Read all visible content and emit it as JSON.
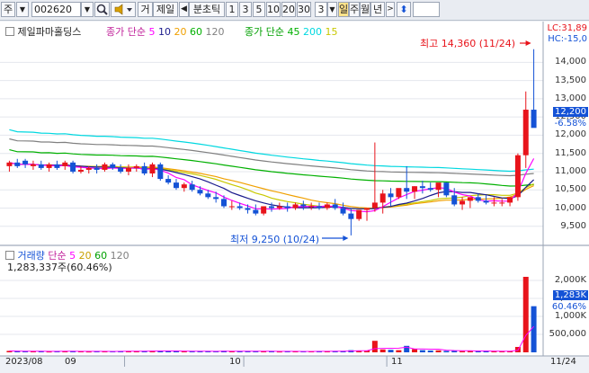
{
  "toolbar": {
    "market_label": "주",
    "code_value": "002620",
    "search_icon": "search-icon",
    "speaker_icon": "speaker-icon",
    "mode_label": "거",
    "name_label": "제일",
    "prev_icon": "arrow-left-icon",
    "period_label": "분초틱",
    "intervals": [
      "1",
      "3",
      "5",
      "10",
      "20",
      "30"
    ],
    "count_value": "3",
    "period_day": "일",
    "period_week": "주",
    "period_month": "월",
    "period_year": "년",
    "next_icon": "arrow-right-icon",
    "updown_icon": "arrows-updown-icon"
  },
  "price_panel": {
    "stock_name": "제일파마홀딩스",
    "ma_title": "종가 단순",
    "ma_periods": [
      "5",
      "10",
      "20",
      "60",
      "120"
    ],
    "ma_long_title": "종가 단순",
    "ma_long_periods": [
      "45",
      "200",
      "15"
    ],
    "lc_label": "LC:31,89",
    "hc_label": "HC:-15,0",
    "high_label": "최고 14,360 (11/24)",
    "low_label": "최저 9,250 (10/24)",
    "current_price": "12,200",
    "change_pct": "-6.58%",
    "y_ticks": [
      "14,000",
      "13,500",
      "13,000",
      "12,500",
      "12,000",
      "11,500",
      "11,000",
      "10,500",
      "10,000",
      "9,500"
    ]
  },
  "volume_panel": {
    "title": "거래량",
    "ma_title": "단순",
    "ma_periods": [
      "5",
      "20",
      "60",
      "120"
    ],
    "volume_value": "1,283,337주(60.46%)",
    "current_volume": "1,283K",
    "current_pct": "60.46%",
    "y_ticks": [
      "2,000K",
      "1,500K",
      "1,000K",
      "500,000"
    ]
  },
  "x_axis": {
    "labels": [
      "2023/08",
      "09",
      "10",
      "11",
      "11/24"
    ]
  },
  "colors": {
    "up": "#e8141b",
    "down": "#1452d6",
    "ma5": "#ff00ff",
    "ma10": "#1a1a8c",
    "ma20": "#f0a000",
    "ma60": "#00b000",
    "ma120": "#808080",
    "ma200": "#00d8e0",
    "ma15": "#c8c800"
  },
  "chart_data": {
    "type": "candlestick",
    "dates": [
      "08/17",
      "08/18",
      "08/21",
      "08/22",
      "08/23",
      "08/24",
      "08/25",
      "08/28",
      "08/29",
      "08/30",
      "08/31",
      "09/01",
      "09/04",
      "09/05",
      "09/06",
      "09/07",
      "09/08",
      "09/11",
      "09/12",
      "09/13",
      "09/14",
      "09/15",
      "09/18",
      "09/19",
      "09/20",
      "09/21",
      "09/22",
      "09/25",
      "09/26",
      "09/27",
      "10/04",
      "10/05",
      "10/06",
      "10/10",
      "10/11",
      "10/12",
      "10/13",
      "10/16",
      "10/17",
      "10/18",
      "10/19",
      "10/20",
      "10/23",
      "10/24",
      "10/25",
      "10/26",
      "10/27",
      "10/30",
      "10/31",
      "11/01",
      "11/02",
      "11/03",
      "11/06",
      "11/07",
      "11/08",
      "11/09",
      "11/10",
      "11/13",
      "11/14",
      "11/15",
      "11/16",
      "11/17",
      "11/20",
      "11/21",
      "11/22",
      "11/23",
      "11/24"
    ],
    "open": [
      11150,
      11250,
      11300,
      11150,
      11200,
      11100,
      11200,
      11150,
      11250,
      11000,
      11050,
      11100,
      11050,
      11200,
      11100,
      11000,
      11100,
      11150,
      10950,
      11200,
      10800,
      10700,
      10550,
      10650,
      10500,
      10400,
      10300,
      10250,
      10050,
      10050,
      10000,
      9950,
      9850,
      10050,
      10000,
      10050,
      10000,
      10100,
      10050,
      10050,
      10000,
      10100,
      10000,
      9850,
      9700,
      9950,
      10000,
      10150,
      10400,
      10300,
      10550,
      10450,
      10600,
      10550,
      10500,
      10700,
      10350,
      10100,
      10200,
      10300,
      10200,
      10150,
      10150,
      10150,
      10300,
      11450,
      12700
    ],
    "high": [
      11300,
      11350,
      11350,
      11300,
      11300,
      11250,
      11300,
      11300,
      11300,
      11150,
      11150,
      11200,
      11250,
      11250,
      11200,
      11200,
      11200,
      11250,
      11250,
      11250,
      10900,
      10800,
      10700,
      10750,
      10600,
      10500,
      10450,
      10350,
      10200,
      10150,
      10100,
      10100,
      10050,
      10150,
      10150,
      10150,
      10150,
      10200,
      10150,
      10150,
      10150,
      10250,
      10150,
      10000,
      9950,
      10000,
      11800,
      10500,
      10550,
      10450,
      11150,
      10600,
      10750,
      10700,
      10650,
      10700,
      10550,
      10300,
      10300,
      10400,
      10350,
      10300,
      10250,
      10300,
      11500,
      13200,
      14360
    ],
    "low": [
      11000,
      11100,
      11100,
      11050,
      11050,
      11000,
      11050,
      11050,
      10950,
      10950,
      10950,
      10950,
      11000,
      11050,
      10950,
      10900,
      11000,
      10900,
      10850,
      10750,
      10650,
      10500,
      10450,
      10450,
      10350,
      10250,
      10150,
      10000,
      9950,
      9950,
      9850,
      9800,
      9800,
      9900,
      9950,
      9900,
      9950,
      9950,
      9950,
      9950,
      9950,
      9950,
      9800,
      9250,
      9650,
      9650,
      9900,
      9850,
      10050,
      10250,
      10250,
      10250,
      10400,
      10450,
      10300,
      10300,
      10050,
      9950,
      10000,
      10150,
      10100,
      10050,
      10050,
      10050,
      10200,
      11100,
      12400
    ],
    "close": [
      11250,
      11150,
      11200,
      11200,
      11100,
      11200,
      11100,
      11250,
      11000,
      11050,
      11100,
      11050,
      11200,
      11100,
      11000,
      11100,
      11150,
      10950,
      11200,
      10800,
      10700,
      10550,
      10650,
      10500,
      10400,
      10300,
      10250,
      10050,
      10050,
      10000,
      9950,
      9850,
      10050,
      10000,
      10050,
      10000,
      10100,
      10050,
      10050,
      10000,
      10100,
      10000,
      9850,
      9700,
      9950,
      10000,
      10150,
      10400,
      10300,
      10550,
      10450,
      10600,
      10550,
      10500,
      10700,
      10350,
      10100,
      10200,
      10300,
      10200,
      10150,
      10150,
      10150,
      10300,
      11450,
      12700,
      12200
    ],
    "volume": [
      40,
      30,
      25,
      35,
      30,
      22,
      28,
      30,
      35,
      25,
      22,
      28,
      30,
      25,
      28,
      35,
      30,
      40,
      45,
      38,
      30,
      35,
      28,
      25,
      30,
      28,
      30,
      45,
      35,
      30,
      28,
      30,
      35,
      25,
      22,
      25,
      30,
      28,
      25,
      30,
      28,
      35,
      40,
      60,
      45,
      50,
      320,
      80,
      70,
      60,
      180,
      90,
      60,
      50,
      55,
      40,
      45,
      35,
      40,
      30,
      35,
      30,
      28,
      35,
      150,
      2100,
      1283
    ],
    "ylim": [
      9100,
      14600
    ],
    "volume_unit": "K"
  }
}
